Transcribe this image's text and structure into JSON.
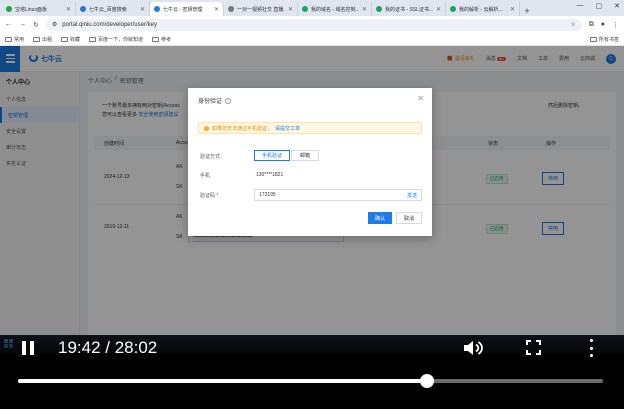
{
  "browser": {
    "tabs": [
      {
        "label": "宝塔Linux面板",
        "color": "#20a53a"
      },
      {
        "label": "七牛云_百度搜索",
        "color": "#2f6fe0"
      },
      {
        "label": "七牛云 - 密钥管理",
        "color": "#1f7be6"
      },
      {
        "label": "一对一视频社交 直播...",
        "color": "#777777"
      },
      {
        "label": "我的域名 - 域名控制...",
        "color": "#1aa260"
      },
      {
        "label": "我的证书 - SSL证书...",
        "color": "#1aa260"
      },
      {
        "label": "我的解析 - 云解析...",
        "color": "#1aa260"
      }
    ],
    "new_tab": "+",
    "url": "portal.qiniu.com/developer/user/key",
    "bookmarks": [
      "常用",
      "出租",
      "收藏",
      "百度一下，你就知道",
      "参考"
    ],
    "all_bookmarks": "所有书签"
  },
  "site": {
    "brand": "七牛云",
    "header_links": {
      "gift": "邀请有礼",
      "message": "消息",
      "badge": "99+",
      "docs": "文档",
      "tickets": "工单",
      "billing": "费用",
      "console": "云商城"
    },
    "avatar_letter": "C"
  },
  "sidenav": {
    "title": "个人中心",
    "items": [
      "个人信息",
      "密钥管理",
      "安全设置",
      "审计日志",
      "实名认证"
    ]
  },
  "content": {
    "breadcrumb": [
      "个人中心",
      "/",
      "密钥管理"
    ],
    "intro1": "一个账号最多拥有两对密钥(Access",
    "intro2_prefix": "您可以查看更多",
    "intro2_link": "安全使用密钥建议",
    "intro_right": "然后删除密钥。",
    "table_headers": [
      "创建时间",
      "Access",
      "状态",
      "操作"
    ],
    "rows": [
      {
        "date": "2024-12-13",
        "status": "已启用",
        "action": "停用",
        "ak": "AK",
        "sk": "SK"
      },
      {
        "date": "2019-12-11",
        "status": "已启用",
        "action": "停用",
        "ak": "AK",
        "sk": "SK",
        "sk_mask": "••••••••••••••••••••••••••••••••••"
      }
    ]
  },
  "modal": {
    "title": "身份验证",
    "warning": "如果您无法通过手机验证，",
    "warning_link": "请提交工单",
    "method_label": "验证方式",
    "method_phone": "手机验证",
    "method_email": "邮箱",
    "phone_label": "手机",
    "phone_value": "130****1821",
    "code_label": "验证码 *",
    "code_value": "173195",
    "resend": "发送",
    "confirm": "确认",
    "cancel": "取消"
  },
  "video": {
    "time": "19:42 / 28:02",
    "progress": 0.699
  }
}
